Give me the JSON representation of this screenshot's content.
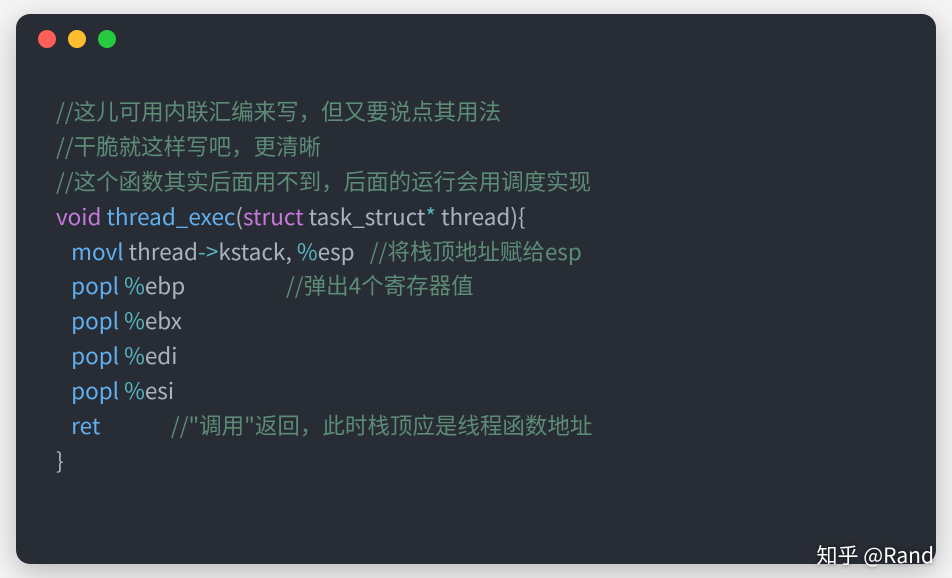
{
  "window": {
    "traffic_lights": [
      "red",
      "yellow",
      "green"
    ]
  },
  "code": {
    "c1": "//这儿可用内联汇编来写，但又要说点其用法",
    "c2": "//干脆就这样写吧，更清晰",
    "c3": "//这个函数其实后面用不到，后面的运行会用调度实现",
    "kw_void": "void",
    "fn_name": "thread_exec",
    "paren_open": "(",
    "kw_struct": "struct",
    "type_task": " task_struct",
    "star": "*",
    "param": " thread",
    "paren_close_brace": "){",
    "i_movl": "movl",
    "expr_thread": " thread",
    "arrow": "->",
    "expr_kstack": "kstack",
    "comma_sp": ", ",
    "pct": "%",
    "reg_esp": "esp",
    "gap1": "   ",
    "cm_esp": "//将栈顶地址赋给esp",
    "i_popl1": "popl",
    "sp": " ",
    "reg_ebp": "ebp",
    "gap2": "                    ",
    "cm_pop": "//弹出4个寄存器值",
    "i_popl2": "popl",
    "reg_ebx": "ebx",
    "i_popl3": "popl",
    "reg_edi": "edi",
    "i_popl4": "popl",
    "reg_esi": "esi",
    "i_ret": "ret",
    "gap3": "              ",
    "cm_ret": "//\"调用\"返回，此时栈顶应是线程函数地址",
    "brace_close": "}",
    "indent": "   "
  },
  "watermark": "知乎 @Rand"
}
